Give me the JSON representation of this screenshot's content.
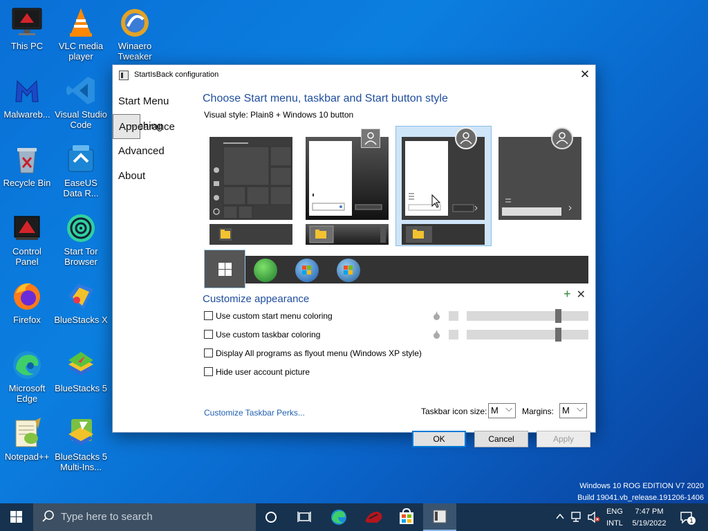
{
  "desktop": {
    "icons": [
      {
        "label": "This PC",
        "icon": "monitor-icon"
      },
      {
        "label": "Malwareb...",
        "icon": "malwarebytes-icon"
      },
      {
        "label": "Recycle Bin",
        "icon": "recycle-bin-icon"
      },
      {
        "label": "Control Panel",
        "icon": "control-panel-icon"
      },
      {
        "label": "Firefox",
        "icon": "firefox-icon"
      },
      {
        "label": "Microsoft Edge",
        "icon": "edge-icon"
      },
      {
        "label": "Notepad++",
        "icon": "notepadpp-icon"
      },
      {
        "label": "VLC media player",
        "icon": "vlc-icon"
      },
      {
        "label": "Visual Studio Code",
        "icon": "vscode-icon"
      },
      {
        "label": "EaseUS Data R...",
        "icon": "easeus-icon"
      },
      {
        "label": "Start Tor Browser",
        "icon": "tor-icon"
      },
      {
        "label": "BlueStacks X",
        "icon": "bluestacks-x-icon"
      },
      {
        "label": "BlueStacks 5",
        "icon": "bluestacks-5-icon"
      },
      {
        "label": "BlueStacks 5 Multi-Ins...",
        "icon": "bluestacks-multi-icon"
      },
      {
        "label": "Winaero Tweaker",
        "icon": "winaero-icon"
      }
    ],
    "watermark_line1": "Windows 10 ROG EDITION V7 2020",
    "watermark_line2": "Build 19041.vb_release.191206-1406"
  },
  "window": {
    "title": "StartIsBack configuration",
    "nav": [
      "Start Menu",
      "Appearance",
      "Switching",
      "Advanced",
      "About"
    ],
    "selected_nav": "Appearance",
    "heading": "Choose Start menu, taskbar and Start button style",
    "visual_style": "Visual style:  Plain8 + Windows 10 button",
    "customize_heading": "Customize appearance",
    "checkboxes": [
      {
        "label": "Use custom start menu coloring",
        "checked": false
      },
      {
        "label": "Use custom taskbar coloring",
        "checked": false
      },
      {
        "label": "Display All programs as flyout menu (Windows XP style)",
        "checked": false
      },
      {
        "label": "Hide user account picture",
        "checked": false
      }
    ],
    "link": "Customize Taskbar Perks...",
    "taskbar_icon_size_label": "Taskbar icon size:",
    "taskbar_icon_size": "M",
    "margins_label": "Margins:",
    "margins": "M",
    "ok": "OK",
    "cancel": "Cancel",
    "apply": "Apply"
  },
  "taskbar": {
    "search_placeholder": "Type here to search",
    "lang1": "ENG",
    "lang2": "INTL",
    "time": "7:47 PM",
    "date": "5/19/2022",
    "notification_count": "1"
  },
  "colors": {
    "accent": "#0078d7",
    "heading": "#1f4e9c",
    "taskbar": "#16324f"
  }
}
